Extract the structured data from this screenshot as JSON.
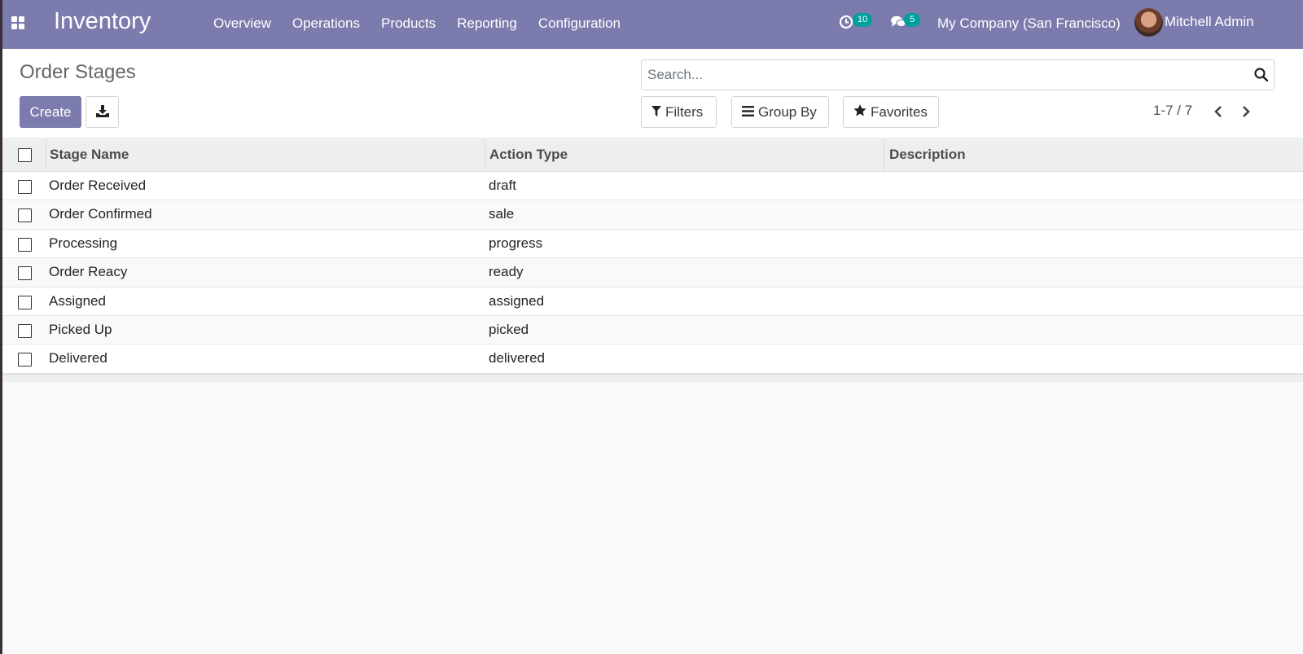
{
  "navbar": {
    "app_name": "Inventory",
    "menu": [
      "Overview",
      "Operations",
      "Products",
      "Reporting",
      "Configuration"
    ],
    "activity_count": "10",
    "message_count": "5",
    "company": "My Company (San Francisco)",
    "user": "Mitchell Admin",
    "accent_color": "#7c7bad",
    "badge_color": "#00a09d"
  },
  "control_panel": {
    "title": "Order Stages",
    "create_label": "Create",
    "search_placeholder": "Search...",
    "filters_label": "Filters",
    "group_by_label": "Group By",
    "favorites_label": "Favorites",
    "pager": "1-7 / 7"
  },
  "table": {
    "columns": [
      "Stage Name",
      "Action Type",
      "Description"
    ],
    "rows": [
      {
        "name": "Order Received",
        "action": "draft",
        "description": ""
      },
      {
        "name": "Order Confirmed",
        "action": "sale",
        "description": ""
      },
      {
        "name": "Processing",
        "action": "progress",
        "description": ""
      },
      {
        "name": "Order Reacy",
        "action": "ready",
        "description": ""
      },
      {
        "name": "Assigned",
        "action": "assigned",
        "description": ""
      },
      {
        "name": "Picked Up",
        "action": "picked",
        "description": ""
      },
      {
        "name": "Delivered",
        "action": "delivered",
        "description": ""
      }
    ]
  }
}
